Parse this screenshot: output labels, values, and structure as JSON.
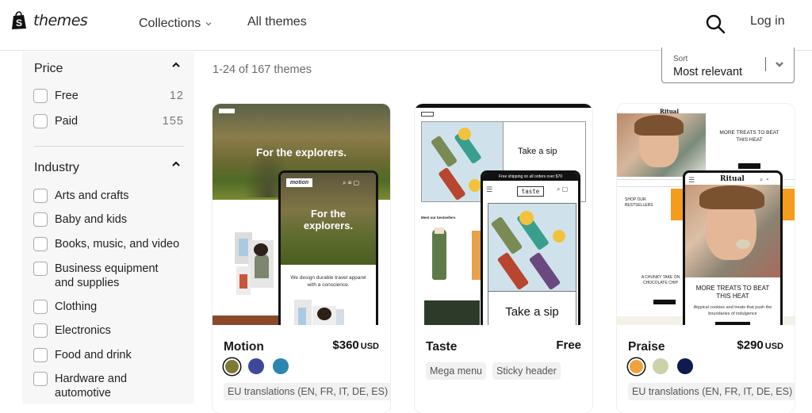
{
  "header": {
    "logo_text": "themes",
    "nav": [
      {
        "label": "Collections",
        "has_dropdown": true
      },
      {
        "label": "All themes"
      }
    ],
    "search_icon": "search-icon",
    "login_label": "Log in"
  },
  "sidebar": {
    "price": {
      "title": "Price",
      "expanded": true,
      "options": [
        {
          "label": "Free",
          "count": "12",
          "checked": false
        },
        {
          "label": "Paid",
          "count": "155",
          "checked": false
        }
      ]
    },
    "industry": {
      "title": "Industry",
      "expanded": true,
      "options": [
        {
          "label": "Arts and crafts",
          "checked": false
        },
        {
          "label": "Baby and kids",
          "checked": false
        },
        {
          "label": "Books, music, and video",
          "checked": false
        },
        {
          "label": "Business equipment and supplies",
          "checked": false
        },
        {
          "label": "Clothing",
          "checked": false
        },
        {
          "label": "Electronics",
          "checked": false
        },
        {
          "label": "Food and drink",
          "checked": false
        },
        {
          "label": "Hardware and automotive",
          "checked": false
        }
      ]
    }
  },
  "main": {
    "results_count": "1-24 of 167 themes",
    "sort": {
      "label": "Sort",
      "value": "Most relevant"
    },
    "themes": [
      {
        "name": "Motion",
        "price": "$360",
        "currency": "USD",
        "swatches": [
          "#7c7a36",
          "#3f479a",
          "#2a85b0"
        ],
        "selected_swatch": 0,
        "tags": [
          "EU translations (EN, FR, IT, DE, ES)"
        ],
        "preview": {
          "desktop_logo": "motion",
          "headline": "For the explorers.",
          "mobile_headline": "For the explorers.",
          "body": "We design durable travel apparel with a conscience."
        }
      },
      {
        "name": "Taste",
        "price": "Free",
        "currency": "",
        "swatches": [],
        "tags": [
          "Mega menu",
          "Sticky header"
        ],
        "preview": {
          "desktop_logo": "taste",
          "announcement": "Free shipping on all orders over $70",
          "headline": "Take a sip",
          "section_title": "Meet our bestsellers"
        }
      },
      {
        "name": "Praise",
        "price": "$290",
        "currency": "USD",
        "swatches": [
          "#eea33e",
          "#ccd1a9",
          "#0f1a4e"
        ],
        "selected_swatch": 0,
        "tags": [
          "EU translations (EN, FR, IT, DE, ES)"
        ],
        "preview": {
          "desktop_logo": "Ritual",
          "headline": "More treats to beat this heat",
          "subtext": "Atypical cookies and treats that push the boundaries of indulgence",
          "bestsellers": "Shop our bestsellers",
          "chunky": "A chunky take on chocolate chip"
        }
      }
    ]
  }
}
